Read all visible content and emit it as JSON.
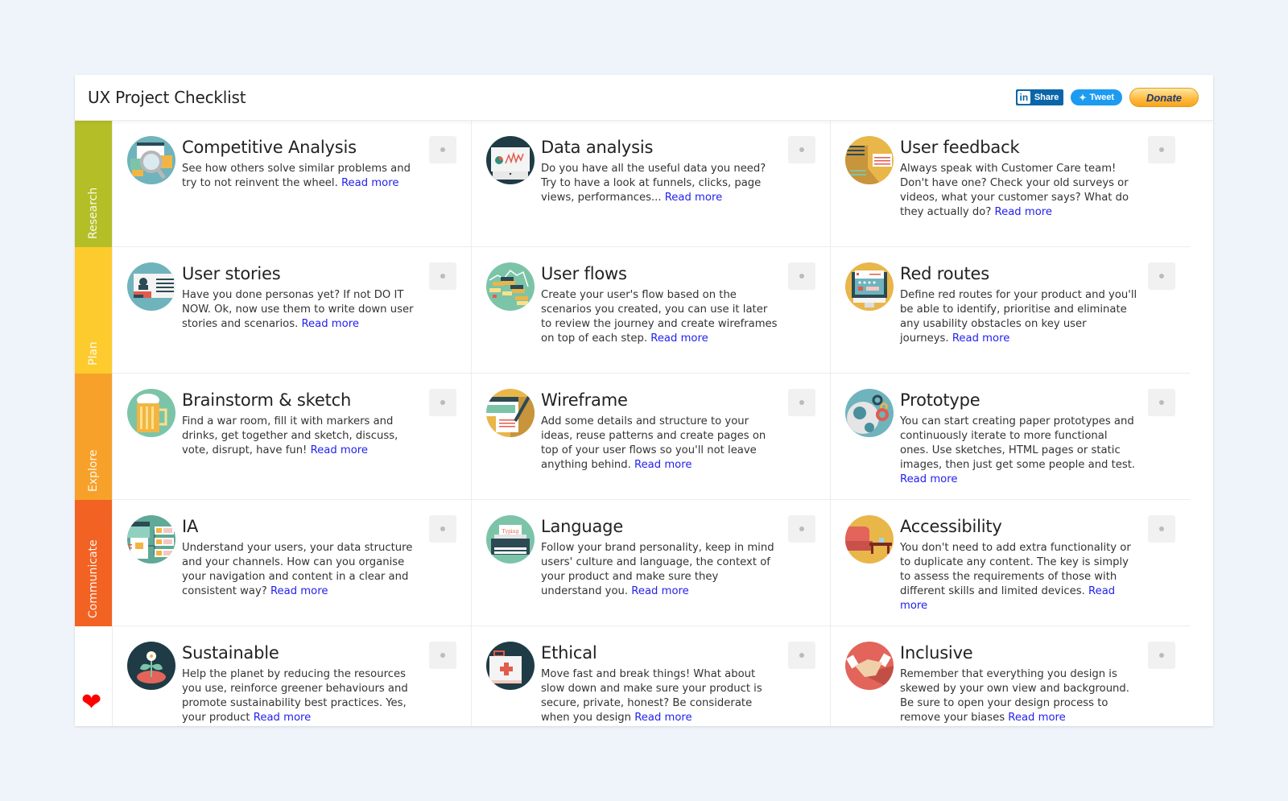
{
  "app": {
    "title": "UX Project Checklist"
  },
  "social": {
    "linkedin_label": "Share",
    "twitter_label": "Tweet",
    "donate_label": "Donate"
  },
  "colors": {
    "research": "#b4be27",
    "plan": "#fdcb2e",
    "explore": "#f7a12a",
    "communicate": "#f26323",
    "link": "#2222ee",
    "heart": "#ff0000"
  },
  "phases": [
    {
      "label": "Research",
      "color": "#b4be27"
    },
    {
      "label": "Plan",
      "color": "#fdcb2e"
    },
    {
      "label": "Explore",
      "color": "#f7a12a"
    },
    {
      "label": "Communicate",
      "color": "#f26323"
    }
  ],
  "heart_icon": "heart-icon",
  "read_more_label": "Read more",
  "cards": [
    {
      "title": "Competitive Analysis",
      "desc": "See how others solve similar problems and try to not reinvent the wheel.",
      "icon": "magnifier-screens-icon",
      "checked": false
    },
    {
      "title": "Data analysis",
      "desc": "Do you have all the useful data you need? Try to have a look at funnels, clicks, page views, performances...",
      "icon": "monitor-chart-icon",
      "checked": false
    },
    {
      "title": "User feedback",
      "desc": "Always speak with Customer Care team! Don't have one? Check your old surveys or videos, what your customer says? What do they actually do?",
      "icon": "speech-bubbles-icon",
      "checked": false
    },
    {
      "title": "User stories",
      "desc": "Have you done personas yet? If not DO IT NOW. Ok, now use them to write down user stories and scenarios.",
      "icon": "persona-card-icon",
      "checked": false
    },
    {
      "title": "User flows",
      "desc": "Create your user's flow based on the scenarios you created, you can use it later to review the journey and create wireframes on top of each step.",
      "icon": "flow-chart-icon",
      "checked": false
    },
    {
      "title": "Red routes",
      "desc": "Define red routes for your product and you'll be able to identify, prioritise and eliminate any usability obstacles on key user journeys.",
      "icon": "monitor-page-icon",
      "checked": false
    },
    {
      "title": "Brainstorm & sketch",
      "desc": "Find a war room, fill it with markers and drinks, get together and sketch, discuss, vote, disrupt, have fun!",
      "icon": "beer-mug-icon",
      "checked": false
    },
    {
      "title": "Wireframe",
      "desc": "Add some details and structure to your ideas, reuse patterns and create pages on top of your user flows so you'll not leave anything behind.",
      "icon": "wireframe-pen-icon",
      "checked": false
    },
    {
      "title": "Prototype",
      "desc": "You can start creating paper prototypes and continuously iterate to more functional ones. Use sketches, HTML pages or static images, then just get some people and test.",
      "icon": "gears-icon",
      "checked": false
    },
    {
      "title": "IA",
      "desc": "Understand your users, your data structure and your channels. How can you organise your navigation and content in a clear and consistent way?",
      "icon": "sitemap-icon",
      "checked": false
    },
    {
      "title": "Language",
      "desc": "Follow your brand personality, keep in mind users' culture and language, the context of your product and make sure they understand you.",
      "icon": "typewriter-icon",
      "typewriter_text": "Typing",
      "checked": false
    },
    {
      "title": "Accessibility",
      "desc": "You don't need to add extra functionality or to duplicate any content. The key is simply to assess the requirements of those with different skills and limited devices.",
      "icon": "armchair-icon",
      "checked": false
    },
    {
      "title": "Sustainable",
      "desc": "Help the planet by reducing the resources you use, reinforce greener behaviours and promote sustainability best practices. Yes, your product",
      "icon": "flower-pot-icon",
      "checked": false
    },
    {
      "title": "Ethical",
      "desc": "Move fast and break things! What about slow down and make sure your product is secure, private, honest? Be considerate when you design",
      "icon": "first-aid-kit-icon",
      "checked": false
    },
    {
      "title": "Inclusive",
      "desc": "Remember that everything you design is skewed by your own view and background. Be sure to open your design process to remove your biases",
      "icon": "handshake-icon",
      "checked": false
    }
  ]
}
